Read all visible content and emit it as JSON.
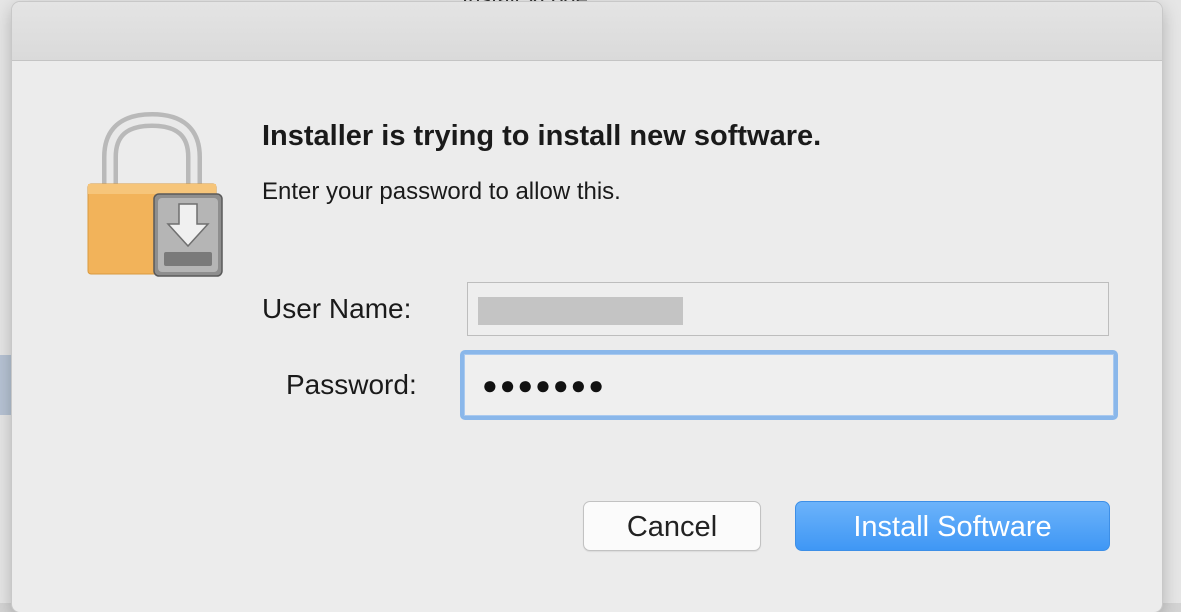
{
  "window": {
    "title": "Install Xcode"
  },
  "dialog": {
    "heading": "Installer is trying to install new software.",
    "subheading": "Enter your password to allow this."
  },
  "form": {
    "username_label": "User Name:",
    "username_value": "",
    "password_label": "Password:",
    "password_value": "●●●●●●●"
  },
  "buttons": {
    "cancel": "Cancel",
    "install": "Install Software"
  },
  "colors": {
    "accent": "#4aa0f7",
    "focus_ring": "#8ab7ea",
    "lock_body": "#f2b35a"
  },
  "icons": {
    "dialog_icon": "lock-install-icon"
  }
}
